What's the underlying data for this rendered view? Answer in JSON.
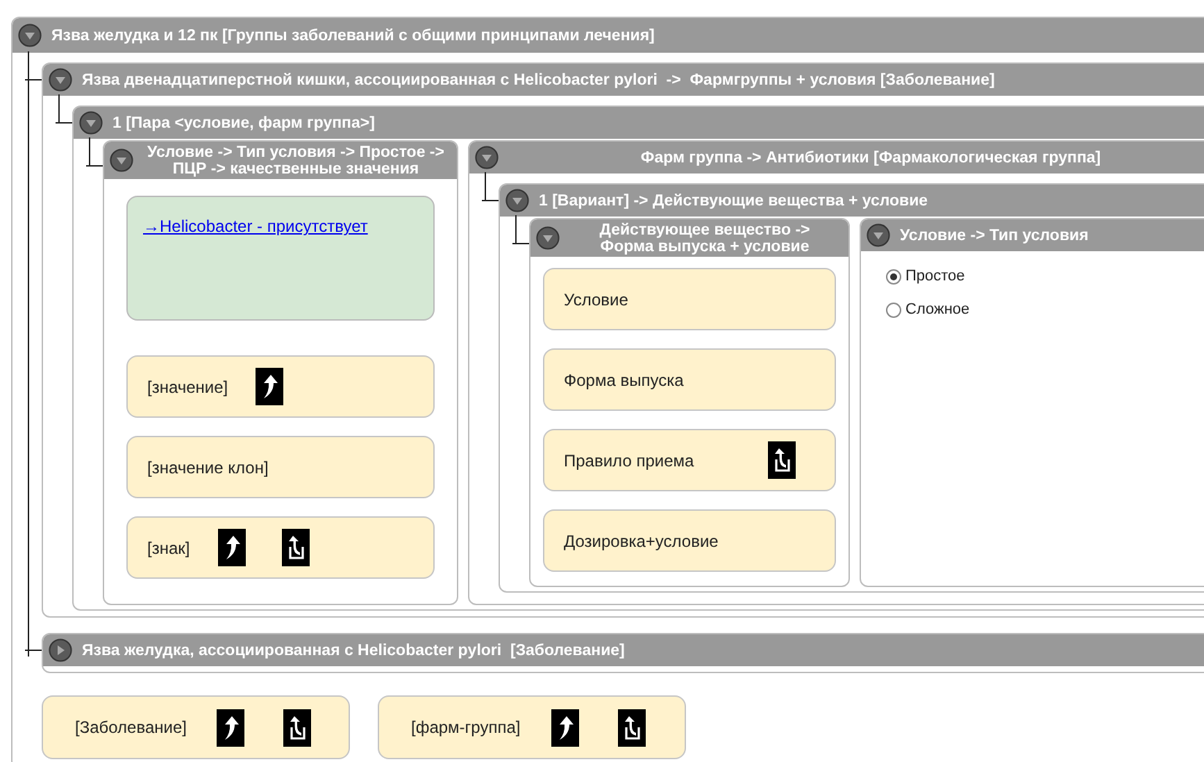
{
  "tree": {
    "title": "Язва желудка и 12 пк [Группы заболеваний с общими принципами лечения]",
    "expanded": true,
    "kind": "stack",
    "children": [
      {
        "title": "Язва двенадцатиперстной кишки, ассоциированная с Helicobacter pylori  ->  Фармгруппы + условия [Заболевание]",
        "expanded": true,
        "kind": "stack",
        "children": [
          {
            "title": "1 [Пара <условие, фарм группа>]",
            "expanded": true,
            "kind": "columns",
            "children": [
              {
                "title": "Условие -> Тип условия -> Простое -> ПЦР -> качественные значения",
                "expanded": true,
                "kind": "values",
                "link": "→Helicobacter - присутствует",
                "cards": [
                  {
                    "label": "[значение]",
                    "icons": [
                      {
                        "kind": "arrow"
                      }
                    ]
                  },
                  {
                    "label": "[значение клон]"
                  },
                  {
                    "label": "[знак]",
                    "icons": [
                      {
                        "kind": "arrow"
                      },
                      {
                        "kind": "box-arrow"
                      }
                    ]
                  }
                ]
              },
              {
                "title": "Фарм группа -> Антибиотики [Фармакологическая группа]",
                "expanded": true,
                "kind": "stack",
                "children": [
                  {
                    "title": "1 [Вариант] -> Действующие вещества + условие",
                    "expanded": true,
                    "kind": "columns",
                    "children": [
                      {
                        "title": "Действующее вещество -> Форма выпуска + условие",
                        "expanded": true,
                        "kind": "substance",
                        "cards": [
                          {
                            "label": "Условие"
                          },
                          {
                            "label": "Форма выпуска"
                          },
                          {
                            "label": "Правило приема",
                            "icons": [
                              {
                                "kind": "box-arrow"
                              }
                            ]
                          },
                          {
                            "label": "Дозировка+условие"
                          }
                        ]
                      },
                      {
                        "title": "Условие -> Тип условия",
                        "expanded": true,
                        "kind": "choice",
                        "options": [
                          {
                            "label": "Простое",
                            "selected": true
                          },
                          {
                            "label": "Сложное",
                            "selected": false
                          }
                        ]
                      }
                    ]
                  }
                ]
              }
            ]
          }
        ]
      },
      {
        "title": "Язва желудка, ассоциированная с Helicobacter pylori  [Заболевание]",
        "expanded": false,
        "kind": "stack"
      }
    ],
    "cards": [
      {
        "label": "[Заболевание]",
        "icons": [
          {
            "kind": "arrow"
          },
          {
            "kind": "box-arrow"
          }
        ]
      },
      {
        "label": "[фарм-группа]",
        "icons": [
          {
            "kind": "arrow"
          },
          {
            "kind": "box-arrow"
          }
        ]
      }
    ]
  }
}
